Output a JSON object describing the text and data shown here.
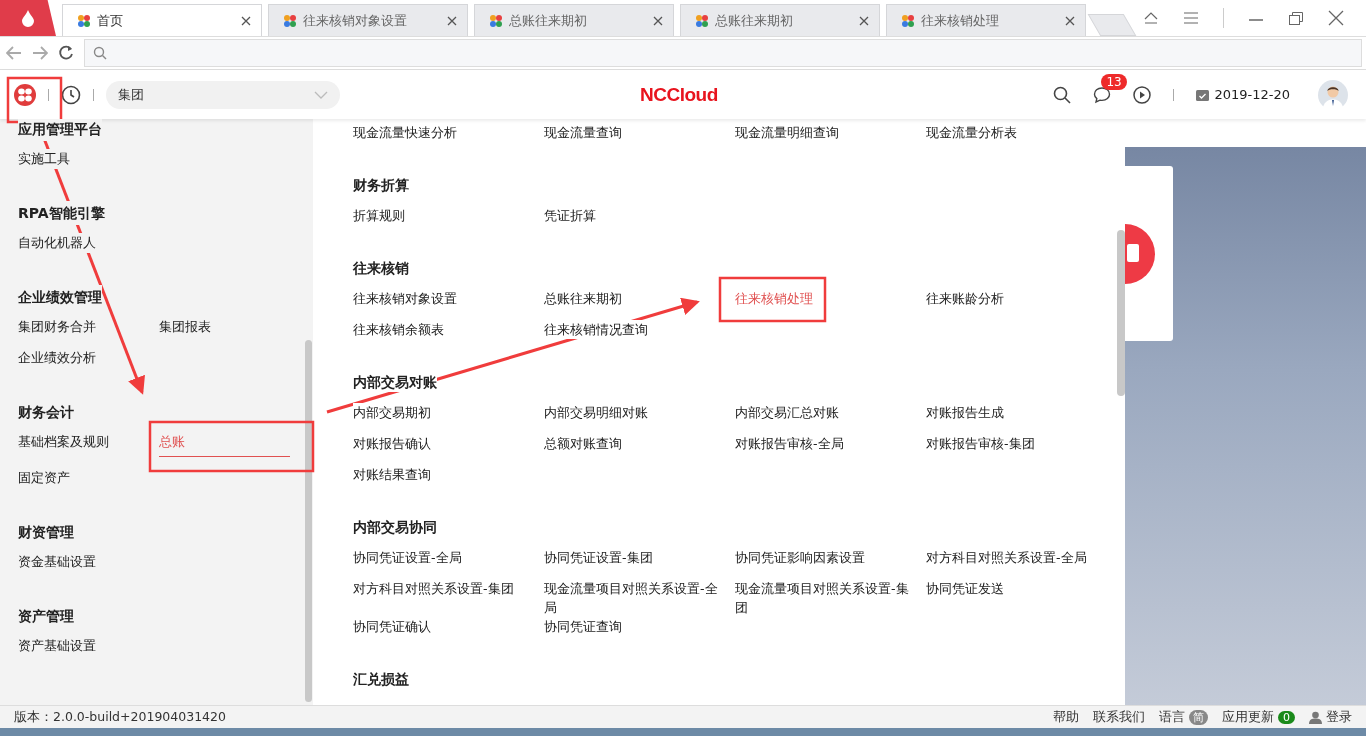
{
  "tabs": [
    {
      "label": "首页",
      "selected": true
    },
    {
      "label": "往来核销对象设置",
      "selected": false
    },
    {
      "label": "总账往来期初",
      "selected": false
    },
    {
      "label": "总账往来期初",
      "selected": false
    },
    {
      "label": "往来核销处理",
      "selected": false
    }
  ],
  "header": {
    "org_select": "集团",
    "logo": "NCCloud",
    "message_count": "13",
    "date": "2019-12-20"
  },
  "sidebar": {
    "groups": [
      {
        "title": "应用管理平台",
        "items": [
          {
            "label": "实施工具",
            "selected": false
          }
        ]
      },
      {
        "title": "RPA智能引擎",
        "items": [
          {
            "label": "自动化机器人",
            "selected": false
          }
        ]
      },
      {
        "title": "企业绩效管理",
        "items": [
          {
            "label": "集团财务合并",
            "selected": false
          },
          {
            "label": "集团报表",
            "selected": false
          },
          {
            "label": "企业绩效分析",
            "selected": false
          }
        ]
      },
      {
        "title": "财务会计",
        "items": [
          {
            "label": "基础档案及规则",
            "selected": false
          },
          {
            "label": "总账",
            "selected": true
          },
          {
            "label": "固定资产",
            "selected": false
          }
        ]
      },
      {
        "title": "财资管理",
        "items": [
          {
            "label": "资金基础设置",
            "selected": false
          }
        ]
      },
      {
        "title": "资产管理",
        "items": [
          {
            "label": "资产基础设置",
            "selected": false
          }
        ]
      }
    ]
  },
  "menu": {
    "groups": [
      {
        "items": [
          {
            "label": "现金流量快速分析",
            "selected": false
          },
          {
            "label": "现金流量查询",
            "selected": false
          },
          {
            "label": "现金流量明细查询",
            "selected": false
          },
          {
            "label": "现金流量分析表",
            "selected": false
          }
        ]
      },
      {
        "title": "财务折算",
        "items": [
          {
            "label": "折算规则",
            "selected": false
          },
          {
            "label": "凭证折算",
            "selected": false
          }
        ]
      },
      {
        "title": "往来核销",
        "items": [
          {
            "label": "往来核销对象设置",
            "selected": false
          },
          {
            "label": "总账往来期初",
            "selected": false
          },
          {
            "label": "往来核销处理",
            "selected": true
          },
          {
            "label": "往来账龄分析",
            "selected": false
          },
          {
            "label": "往来核销余额表",
            "selected": false
          },
          {
            "label": "往来核销情况查询",
            "selected": false
          }
        ]
      },
      {
        "title": "内部交易对账",
        "items": [
          {
            "label": "内部交易期初",
            "selected": false
          },
          {
            "label": "内部交易明细对账",
            "selected": false
          },
          {
            "label": "内部交易汇总对账",
            "selected": false
          },
          {
            "label": "对账报告生成",
            "selected": false
          },
          {
            "label": "对账报告确认",
            "selected": false
          },
          {
            "label": "总额对账查询",
            "selected": false
          },
          {
            "label": "对账报告审核-全局",
            "selected": false
          },
          {
            "label": "对账报告审核-集团",
            "selected": false
          },
          {
            "label": "对账结果查询",
            "selected": false
          }
        ]
      },
      {
        "title": "内部交易协同",
        "items": [
          {
            "label": "协同凭证设置-全局",
            "selected": false
          },
          {
            "label": "协同凭证设置-集团",
            "selected": false
          },
          {
            "label": "协同凭证影响因素设置",
            "selected": false
          },
          {
            "label": "对方科目对照关系设置-全局",
            "selected": false
          },
          {
            "label": "对方科目对照关系设置-集团",
            "selected": false
          },
          {
            "label": "现金流量项目对照关系设置-全局",
            "selected": false
          },
          {
            "label": "现金流量项目对照关系设置-集团",
            "selected": false
          },
          {
            "label": "协同凭证发送",
            "selected": false
          },
          {
            "label": "协同凭证确认",
            "selected": false
          },
          {
            "label": "协同凭证查询",
            "selected": false
          }
        ]
      },
      {
        "title": "汇兑损益"
      }
    ]
  },
  "status_bar": {
    "version": "版本：2.0.0-build+201904031420",
    "links": [
      "帮助",
      "联系我们"
    ],
    "language": {
      "label": "语言",
      "badge": "简"
    },
    "update": {
      "label": "应用更新",
      "badge": "0"
    },
    "login": "登录"
  }
}
